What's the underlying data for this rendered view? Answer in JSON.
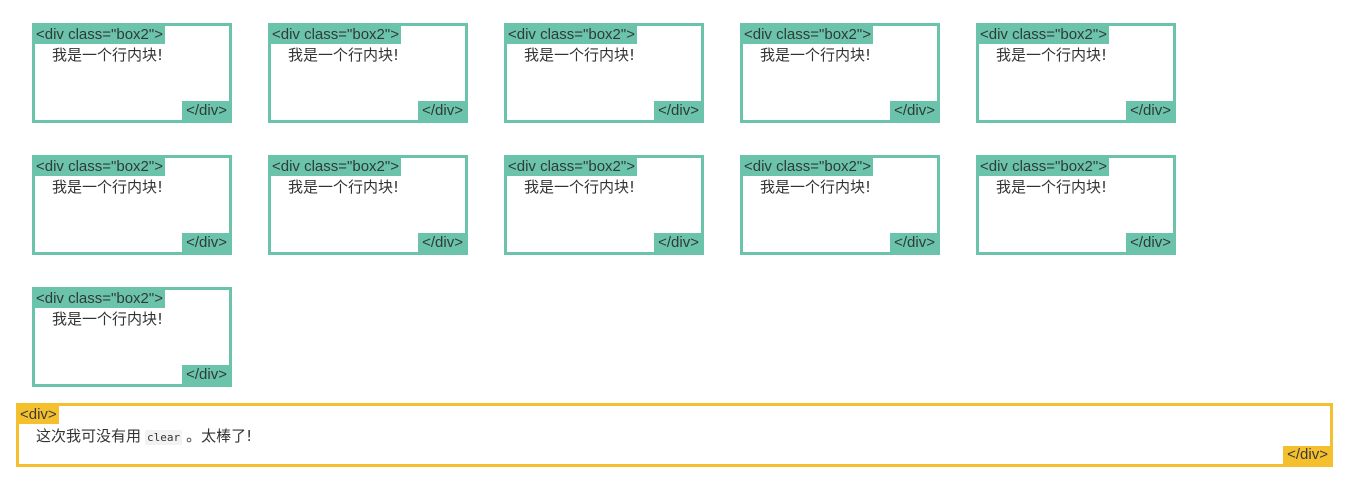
{
  "boxes": {
    "open_tag": "<div class=\"box2\">",
    "text": "我是一个行内块!",
    "close_tag": "</div>",
    "count": 11,
    "border_color": "#6cc3ab"
  },
  "container": {
    "open_tag": "<div>",
    "text_before": "这次我可没有用",
    "code": "clear",
    "text_after": "。太棒了!",
    "close_tag": "</div>",
    "border_color": "#f5c02e"
  }
}
